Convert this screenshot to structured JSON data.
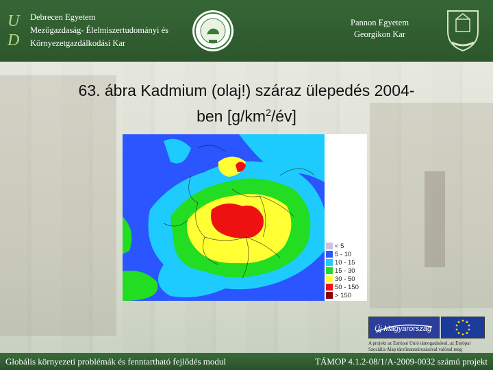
{
  "header": {
    "left_lines": [
      "Debrecen Egyetem",
      "Mezőgazdaság- Élelmiszertudományi és",
      "Környezetgazdálkodási Kar"
    ],
    "right_lines": [
      "Pannon Egyetem",
      "Georgikon Kar"
    ]
  },
  "slide": {
    "title_main": "63. ábra Kadmium (olaj!) száraz ülepedés 2004-",
    "title_line2_prefix": "ben [g/km",
    "title_sup": "2",
    "title_line2_suffix": "/év]"
  },
  "legend": {
    "items": [
      {
        "label": "< 5",
        "color": "#c7c2e6"
      },
      {
        "label": "5 - 10",
        "color": "#2a55ff"
      },
      {
        "label": "10 - 15",
        "color": "#1ecbff"
      },
      {
        "label": "15 - 30",
        "color": "#22dd22"
      },
      {
        "label": "30 - 50",
        "color": "#ffff33"
      },
      {
        "label": "50 - 150",
        "color": "#ee1111"
      },
      {
        "label": "> 150",
        "color": "#8a0000"
      }
    ]
  },
  "footer": {
    "left": "Globális környezeti problémák és fenntartható fejlődés modul",
    "right": "TÁMOP 4.1.2-08/1/A-2009-0032 számú projekt"
  },
  "eu_notice": {
    "line1": "A projekt az Európai Unió támogatásával, az Európai",
    "line2": "Szociális Alap társfinanszírozásával valósul meg"
  },
  "badge_text": {
    "um": "Új Magyarország"
  }
}
